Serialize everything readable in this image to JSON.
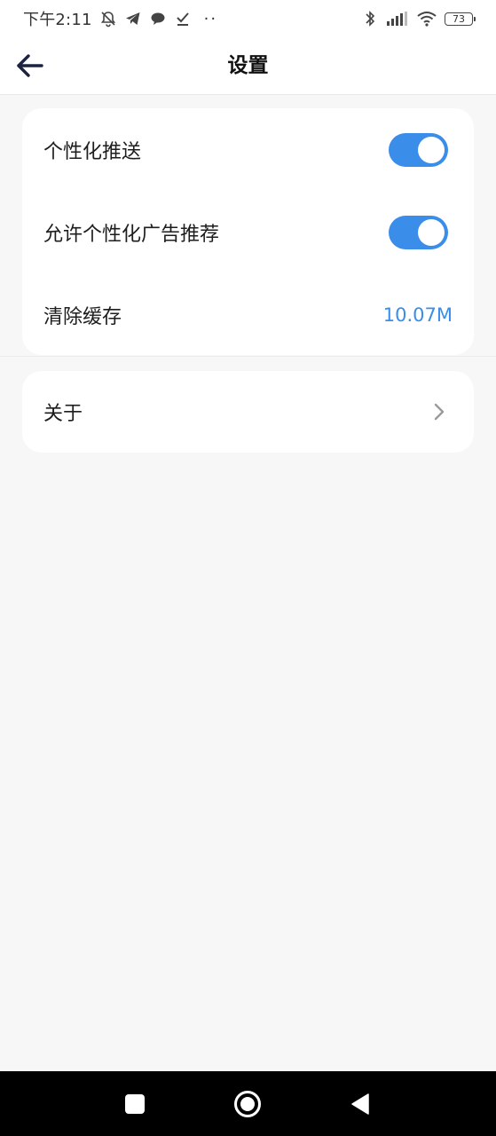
{
  "status_bar": {
    "time": "下午2:11",
    "battery": "73",
    "more_dots": "··"
  },
  "header": {
    "title": "设置"
  },
  "settings": {
    "personalized_push": {
      "label": "个性化推送",
      "enabled": true
    },
    "personalized_ads": {
      "label": "允许个性化广告推荐",
      "enabled": true
    },
    "clear_cache": {
      "label": "清除缓存",
      "value": "10.07M"
    },
    "about": {
      "label": "关于"
    }
  },
  "colors": {
    "accent": "#3a8de8",
    "background": "#f7f7f7",
    "card": "#ffffff"
  },
  "icons": {
    "back": "back-arrow-icon",
    "chevron": "chevron-right-icon",
    "nav_recent": "square-icon",
    "nav_home": "circle-icon",
    "nav_back": "triangle-back-icon"
  }
}
